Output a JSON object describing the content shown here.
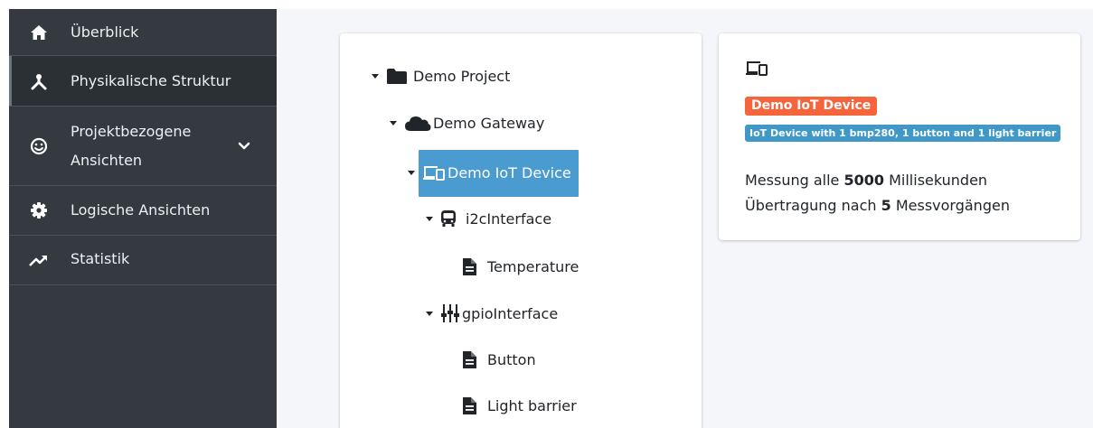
{
  "sidebar": {
    "items": [
      {
        "label": "Überblick",
        "icon": "home-icon"
      },
      {
        "label": "Physikalische Struktur",
        "icon": "hierarchy-icon",
        "active": true
      },
      {
        "label_line1": "Projektbezogene",
        "label_line2": "Ansichten",
        "icon": "smiley-icon",
        "expandable": true
      },
      {
        "label": "Logische Ansichten",
        "icon": "gear-icon"
      },
      {
        "label": "Statistik",
        "icon": "trend-icon"
      }
    ]
  },
  "tree": {
    "nodes": [
      {
        "label": "Demo Project",
        "icon": "folder-icon",
        "depth": 0,
        "expanded": true
      },
      {
        "label": "Demo Gateway",
        "icon": "cloud-icon",
        "depth": 1,
        "expanded": true
      },
      {
        "label": "Demo IoT Device",
        "icon": "devices-icon",
        "depth": 2,
        "expanded": true,
        "selected": true
      },
      {
        "label": "i2cInterface",
        "icon": "bus-icon",
        "depth": 3,
        "expanded": true
      },
      {
        "label": "Temperature",
        "icon": "file-icon",
        "depth": 4
      },
      {
        "label": "gpioInterface",
        "icon": "sliders-icon",
        "depth": 3,
        "expanded": true
      },
      {
        "label": "Button",
        "icon": "file-icon",
        "depth": 4
      },
      {
        "label": "Light barrier",
        "icon": "file-icon",
        "depth": 4
      }
    ]
  },
  "detail": {
    "icon": "devices-icon",
    "name_badge": "Demo IoT Device",
    "description_badge": "IoT Device with 1 bmp280, 1 button and 1 light barrier",
    "measure_prefix": "Messung alle",
    "measure_value": "5000",
    "measure_suffix": "Millisekunden",
    "transfer_prefix": "Übertragung nach",
    "transfer_value": "5",
    "transfer_suffix": "Messvorgängen"
  },
  "colors": {
    "sidebar_bg": "#343a40",
    "selected_bg": "#4a9bd0",
    "badge_orange": "#f6643c",
    "badge_blue": "#3f98c8"
  }
}
